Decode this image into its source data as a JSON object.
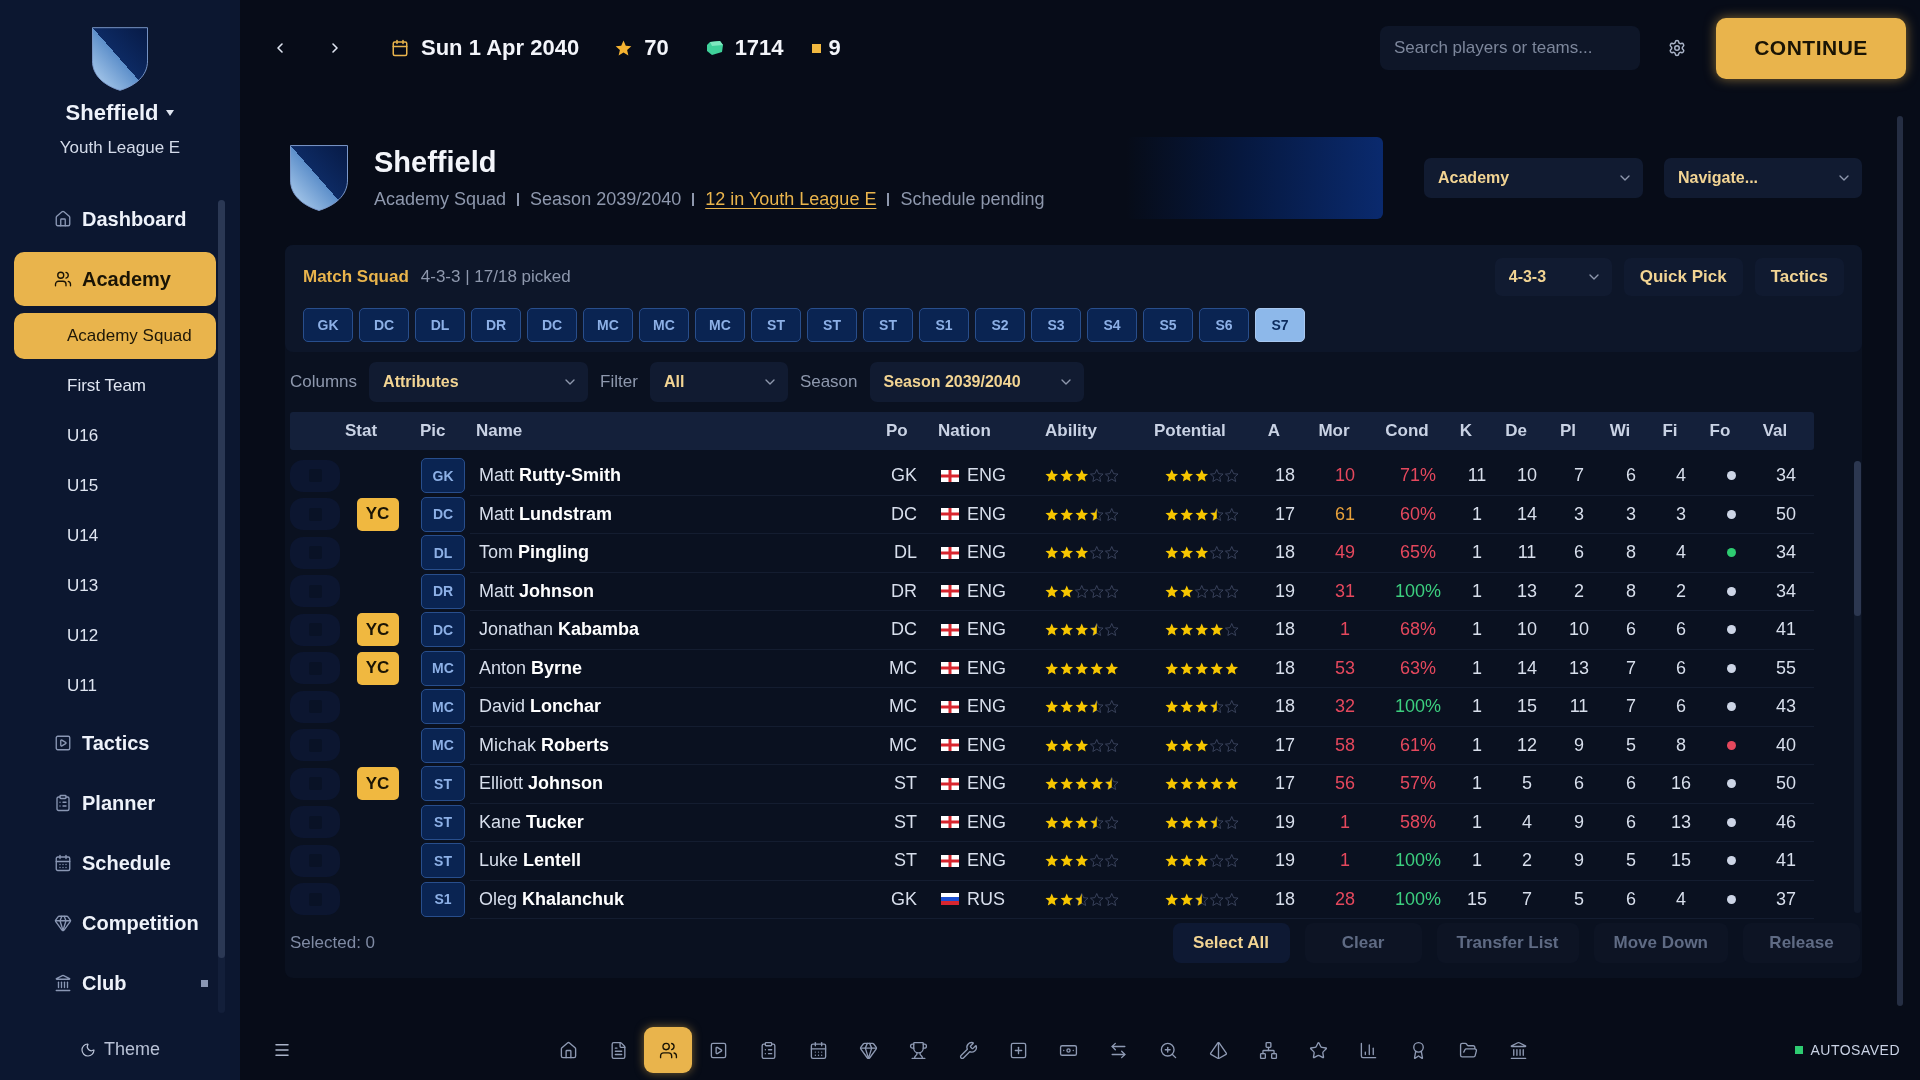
{
  "sidebar": {
    "club": "Sheffield",
    "league": "Youth League E",
    "items": [
      {
        "label": "Dashboard",
        "selected": false,
        "dot": false
      },
      {
        "label": "Academy",
        "selected": true,
        "dot": false,
        "children": [
          {
            "label": "Academy Squad",
            "selected": true
          },
          {
            "label": "First Team",
            "selected": false
          },
          {
            "label": "U16",
            "selected": false
          },
          {
            "label": "U15",
            "selected": false
          },
          {
            "label": "U14",
            "selected": false
          },
          {
            "label": "U13",
            "selected": false
          },
          {
            "label": "U12",
            "selected": false
          },
          {
            "label": "U11",
            "selected": false
          }
        ]
      },
      {
        "label": "Tactics",
        "selected": false,
        "dot": false
      },
      {
        "label": "Planner",
        "selected": false,
        "dot": false
      },
      {
        "label": "Schedule",
        "selected": false,
        "dot": false
      },
      {
        "label": "Competition",
        "selected": false,
        "dot": false
      },
      {
        "label": "Club",
        "selected": false,
        "dot": true
      }
    ],
    "theme": "Theme"
  },
  "topbar": {
    "date": "Sun 1 Apr 2040",
    "stats": [
      "70",
      "1714",
      "9"
    ],
    "search": {
      "placeholder": "Search players or teams..."
    },
    "action": "CONTINUE"
  },
  "header": {
    "title": "Sheffield",
    "meta": [
      {
        "text": "Academy Squad",
        "link": false
      },
      {
        "text": "Season 2039/2040",
        "link": false
      },
      {
        "text": "12 in Youth League E",
        "link": true
      },
      {
        "text": "Schedule pending",
        "link": false
      }
    ],
    "dropdowns": [
      "Academy",
      "Navigate..."
    ]
  },
  "match_squad": {
    "title": "Match Squad",
    "summary": "4-3-3 | 17/18 picked",
    "formation": "4-3-3",
    "buttons": [
      "Quick Pick",
      "Tactics"
    ],
    "slots": [
      {
        "label": "GK",
        "selected": false
      },
      {
        "label": "DC",
        "selected": false
      },
      {
        "label": "DL",
        "selected": false
      },
      {
        "label": "DR",
        "selected": false
      },
      {
        "label": "DC",
        "selected": false
      },
      {
        "label": "MC",
        "selected": false
      },
      {
        "label": "MC",
        "selected": false
      },
      {
        "label": "MC",
        "selected": false
      },
      {
        "label": "ST",
        "selected": false
      },
      {
        "label": "ST",
        "selected": false
      },
      {
        "label": "ST",
        "selected": false
      },
      {
        "label": "S1",
        "selected": false
      },
      {
        "label": "S2",
        "selected": false
      },
      {
        "label": "S3",
        "selected": false
      },
      {
        "label": "S4",
        "selected": false
      },
      {
        "label": "S5",
        "selected": false
      },
      {
        "label": "S6",
        "selected": false
      },
      {
        "label": "S7",
        "selected": true
      }
    ]
  },
  "filters": [
    {
      "label": "Columns",
      "value": "Attributes"
    },
    {
      "label": "Filter",
      "value": "All"
    },
    {
      "label": "Season",
      "value": "Season 2039/2040"
    }
  ],
  "table": {
    "columns": [
      "Stat",
      "Pic",
      "Name",
      "Po",
      "Nation",
      "Ability",
      "Potential",
      "A",
      "Mor",
      "Cond",
      "K",
      "De",
      "Pl",
      "Wi",
      "Fi",
      "Fo",
      "Val"
    ],
    "rows": [
      {
        "checked": false,
        "pic": "GK",
        "name": "Matt **Rutty-Smith**",
        "po": "GK",
        "nation": {
          "code": "ENG",
          "kind": "cross"
        },
        "ability": {
          "stars": 3
        },
        "potential": {
          "stars": 3
        },
        "a": "18",
        "mor": {
          "text": "10",
          "color": "#e5485d"
        },
        "cond": {
          "text": "71%",
          "color": "#e5485d"
        },
        "k": "11",
        "de": "10",
        "pl": "7",
        "wi": "6",
        "fi": "4",
        "fo": {
          "color": "#cdd5e6"
        },
        "val": "34"
      },
      {
        "checked": false,
        "stat": "YC",
        "pic": "DC",
        "name": "Matt **Lundstram**",
        "po": "DC",
        "nation": {
          "code": "ENG",
          "kind": "cross"
        },
        "ability": {
          "stars": 3.5
        },
        "potential": {
          "stars": 3.5
        },
        "a": "17",
        "mor": {
          "text": "61",
          "color": "#e9a23b"
        },
        "cond": {
          "text": "60%",
          "color": "#e5485d"
        },
        "k": "1",
        "de": "14",
        "pl": "3",
        "wi": "3",
        "fi": "3",
        "fo": {
          "color": "#cdd5e6"
        },
        "val": "50"
      },
      {
        "checked": false,
        "pic": "DL",
        "name": "Tom **Pingling**",
        "po": "DL",
        "nation": {
          "code": "ENG",
          "kind": "cross"
        },
        "ability": {
          "stars": 3
        },
        "potential": {
          "stars": 3
        },
        "a": "18",
        "mor": {
          "text": "49",
          "color": "#e5485d"
        },
        "cond": {
          "text": "65%",
          "color": "#e5485d"
        },
        "k": "1",
        "de": "11",
        "pl": "6",
        "wi": "8",
        "fi": "4",
        "fo": {
          "color": "#2ecc71"
        },
        "val": "34"
      },
      {
        "checked": false,
        "pic": "DR",
        "name": "Matt **Johnson**",
        "po": "DR",
        "nation": {
          "code": "ENG",
          "kind": "cross"
        },
        "ability": {
          "stars": 2
        },
        "potential": {
          "stars": 2
        },
        "a": "19",
        "mor": {
          "text": "31",
          "color": "#e5485d"
        },
        "cond": {
          "text": "100%",
          "color": "#3ccf7f"
        },
        "k": "1",
        "de": "13",
        "pl": "2",
        "wi": "8",
        "fi": "2",
        "fo": {
          "color": "#cdd5e6"
        },
        "val": "34"
      },
      {
        "checked": false,
        "stat": "YC",
        "pic": "DC",
        "name": "Jonathan **Kabamba**",
        "po": "DC",
        "nation": {
          "code": "ENG",
          "kind": "cross"
        },
        "ability": {
          "stars": 3.5
        },
        "potential": {
          "stars": 4
        },
        "a": "18",
        "mor": {
          "text": "1",
          "color": "#e5485d"
        },
        "cond": {
          "text": "68%",
          "color": "#e5485d"
        },
        "k": "1",
        "de": "10",
        "pl": "10",
        "wi": "6",
        "fi": "6",
        "fo": {
          "color": "#cdd5e6"
        },
        "val": "41"
      },
      {
        "checked": false,
        "stat": "YC",
        "pic": "MC",
        "name": "Anton **Byrne**",
        "po": "MC",
        "nation": {
          "code": "ENG",
          "kind": "cross"
        },
        "ability": {
          "stars": 5
        },
        "potential": {
          "stars": 5
        },
        "a": "18",
        "mor": {
          "text": "53",
          "color": "#e5485d"
        },
        "cond": {
          "text": "63%",
          "color": "#e5485d"
        },
        "k": "1",
        "de": "14",
        "pl": "13",
        "wi": "7",
        "fi": "6",
        "fo": {
          "color": "#cdd5e6"
        },
        "val": "55"
      },
      {
        "checked": false,
        "pic": "MC",
        "name": "David **Lonchar**",
        "po": "MC",
        "nation": {
          "code": "ENG",
          "kind": "cross"
        },
        "ability": {
          "stars": 3.5
        },
        "potential": {
          "stars": 3.5
        },
        "a": "18",
        "mor": {
          "text": "32",
          "color": "#e5485d"
        },
        "cond": {
          "text": "100%",
          "color": "#3ccf7f"
        },
        "k": "1",
        "de": "15",
        "pl": "11",
        "wi": "7",
        "fi": "6",
        "fo": {
          "color": "#cdd5e6"
        },
        "val": "43"
      },
      {
        "checked": false,
        "pic": "MC",
        "name": "Michak **Roberts**",
        "po": "MC",
        "nation": {
          "code": "ENG",
          "kind": "cross"
        },
        "ability": {
          "stars": 3
        },
        "potential": {
          "stars": 3
        },
        "a": "17",
        "mor": {
          "text": "58",
          "color": "#e5485d"
        },
        "cond": {
          "text": "61%",
          "color": "#e5485d"
        },
        "k": "1",
        "de": "12",
        "pl": "9",
        "wi": "5",
        "fi": "8",
        "fo": {
          "color": "#e5485d"
        },
        "val": "40"
      },
      {
        "checked": false,
        "stat": "YC",
        "pic": "ST",
        "name": "Elliott **Johnson**",
        "po": "ST",
        "nation": {
          "code": "ENG",
          "kind": "cross"
        },
        "ability": {
          "stars": 4.5
        },
        "potential": {
          "stars": 5
        },
        "a": "17",
        "mor": {
          "text": "56",
          "color": "#e5485d"
        },
        "cond": {
          "text": "57%",
          "color": "#e5485d"
        },
        "k": "1",
        "de": "5",
        "pl": "6",
        "wi": "6",
        "fi": "16",
        "fo": {
          "color": "#cdd5e6"
        },
        "val": "50"
      },
      {
        "checked": false,
        "pic": "ST",
        "name": "Kane **Tucker**",
        "po": "ST",
        "nation": {
          "code": "ENG",
          "kind": "cross"
        },
        "ability": {
          "stars": 3.5
        },
        "potential": {
          "stars": 3.5
        },
        "a": "19",
        "mor": {
          "text": "1",
          "color": "#e5485d"
        },
        "cond": {
          "text": "58%",
          "color": "#e5485d"
        },
        "k": "1",
        "de": "4",
        "pl": "9",
        "wi": "6",
        "fi": "13",
        "fo": {
          "color": "#cdd5e6"
        },
        "val": "46"
      },
      {
        "checked": false,
        "pic": "ST",
        "name": "Luke **Lentell**",
        "po": "ST",
        "nation": {
          "code": "ENG",
          "kind": "cross"
        },
        "ability": {
          "stars": 3
        },
        "potential": {
          "stars": 3
        },
        "a": "19",
        "mor": {
          "text": "1",
          "color": "#e5485d"
        },
        "cond": {
          "text": "100%",
          "color": "#3ccf7f"
        },
        "k": "1",
        "de": "2",
        "pl": "9",
        "wi": "5",
        "fi": "15",
        "fo": {
          "color": "#cdd5e6"
        },
        "val": "41"
      },
      {
        "checked": false,
        "pic": "S1",
        "name": "Oleg **Khalanchuk**",
        "po": "GK",
        "nation": {
          "code": "RUS",
          "kind": "tricolor"
        },
        "ability": {
          "stars": 2.5
        },
        "potential": {
          "stars": 2.5
        },
        "a": "18",
        "mor": {
          "text": "28",
          "color": "#e5485d"
        },
        "cond": {
          "text": "100%",
          "color": "#3ccf7f"
        },
        "k": "15",
        "de": "7",
        "pl": "5",
        "wi": "6",
        "fi": "4",
        "fo": {
          "color": "#cdd5e6"
        },
        "val": "37"
      }
    ]
  },
  "footer": {
    "selection": "Selected: 0",
    "buttons": [
      {
        "label": "Select All",
        "disabled": false
      },
      {
        "label": "Clear",
        "disabled": true
      },
      {
        "label": "Transfer List",
        "disabled": true
      },
      {
        "label": "Move Down",
        "disabled": true
      },
      {
        "label": "Release",
        "disabled": true
      }
    ]
  },
  "dock": {
    "items": [
      {
        "selected": false
      },
      {
        "selected": false
      },
      {
        "selected": true
      },
      {
        "selected": false
      },
      {
        "selected": false
      },
      {
        "selected": false
      },
      {
        "selected": false
      },
      {
        "selected": false
      },
      {
        "selected": false
      },
      {
        "selected": false
      },
      {
        "selected": false
      },
      {
        "selected": false
      },
      {
        "selected": false
      },
      {
        "selected": false
      },
      {
        "selected": false
      },
      {
        "selected": false
      },
      {
        "selected": false
      },
      {
        "selected": false
      },
      {
        "selected": false
      },
      {
        "selected": false
      }
    ],
    "status": "AUTOSAVED"
  }
}
